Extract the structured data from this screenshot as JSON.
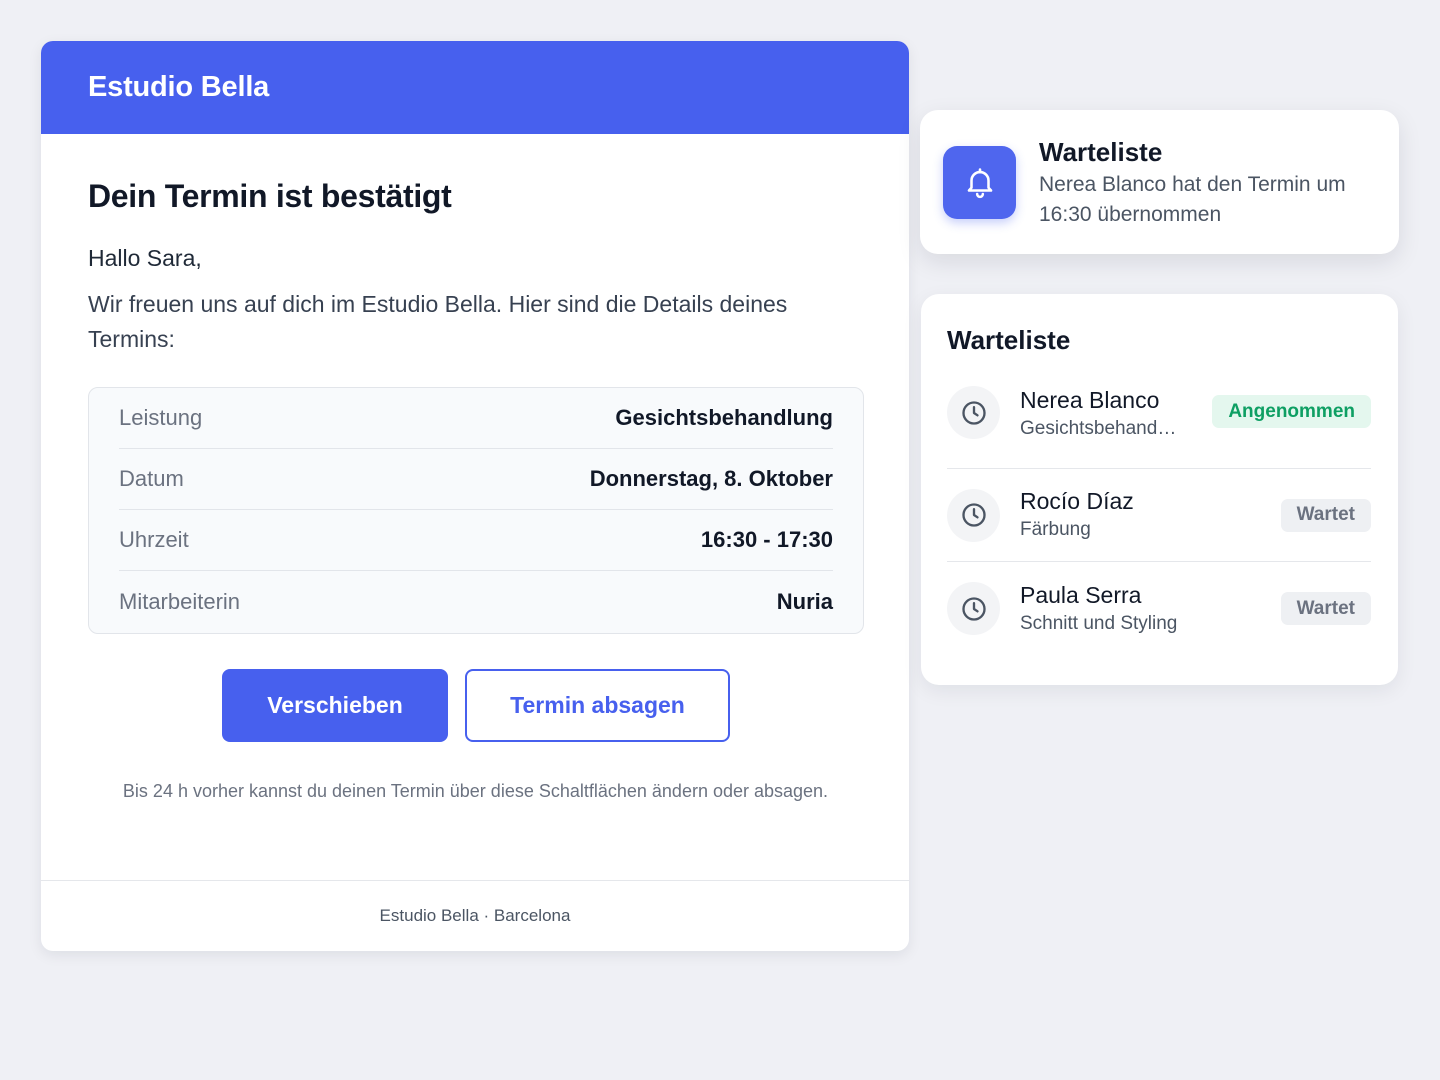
{
  "email": {
    "brand": "Estudio Bella",
    "title": "Dein Termin ist bestätigt",
    "greeting": "Hallo Sara,",
    "intro": "Wir freuen uns auf dich im Estudio Bella. Hier sind die Details deines Termins:",
    "details": [
      {
        "label": "Leistung",
        "value": "Gesichtsbehandlung"
      },
      {
        "label": "Datum",
        "value": "Donnerstag, 8. Oktober"
      },
      {
        "label": "Uhrzeit",
        "value": "16:30 - 17:30"
      },
      {
        "label": "Mitarbeiterin",
        "value": "Nuria"
      }
    ],
    "buttons": {
      "reschedule": "Verschieben",
      "cancel": "Termin absagen"
    },
    "note": "Bis 24 h vorher kannst du deinen Termin über diese Schaltflächen ändern oder absagen.",
    "footer": "Estudio Bella · Barcelona"
  },
  "notification": {
    "icon": "bell-icon",
    "title": "Warteliste",
    "message": "Nerea Blanco hat den Termin um 16:30 übernommen"
  },
  "waitlist": {
    "title": "Warteliste",
    "items": [
      {
        "icon": "clock-icon",
        "name": "Nerea Blanco",
        "service": "Gesichtsbehandlung",
        "status": "Angenommen",
        "status_type": "accepted"
      },
      {
        "icon": "clock-icon",
        "name": "Rocío Díaz",
        "service": "Färbung",
        "status": "Wartet",
        "status_type": "waiting"
      },
      {
        "icon": "clock-icon",
        "name": "Paula Serra",
        "service": "Schnitt und Styling",
        "status": "Wartet",
        "status_type": "waiting"
      }
    ]
  },
  "colors": {
    "brand": "#4760ee",
    "page_background": "#eff0f5",
    "accepted": "#0e9f63",
    "waiting": "#6b7280"
  }
}
